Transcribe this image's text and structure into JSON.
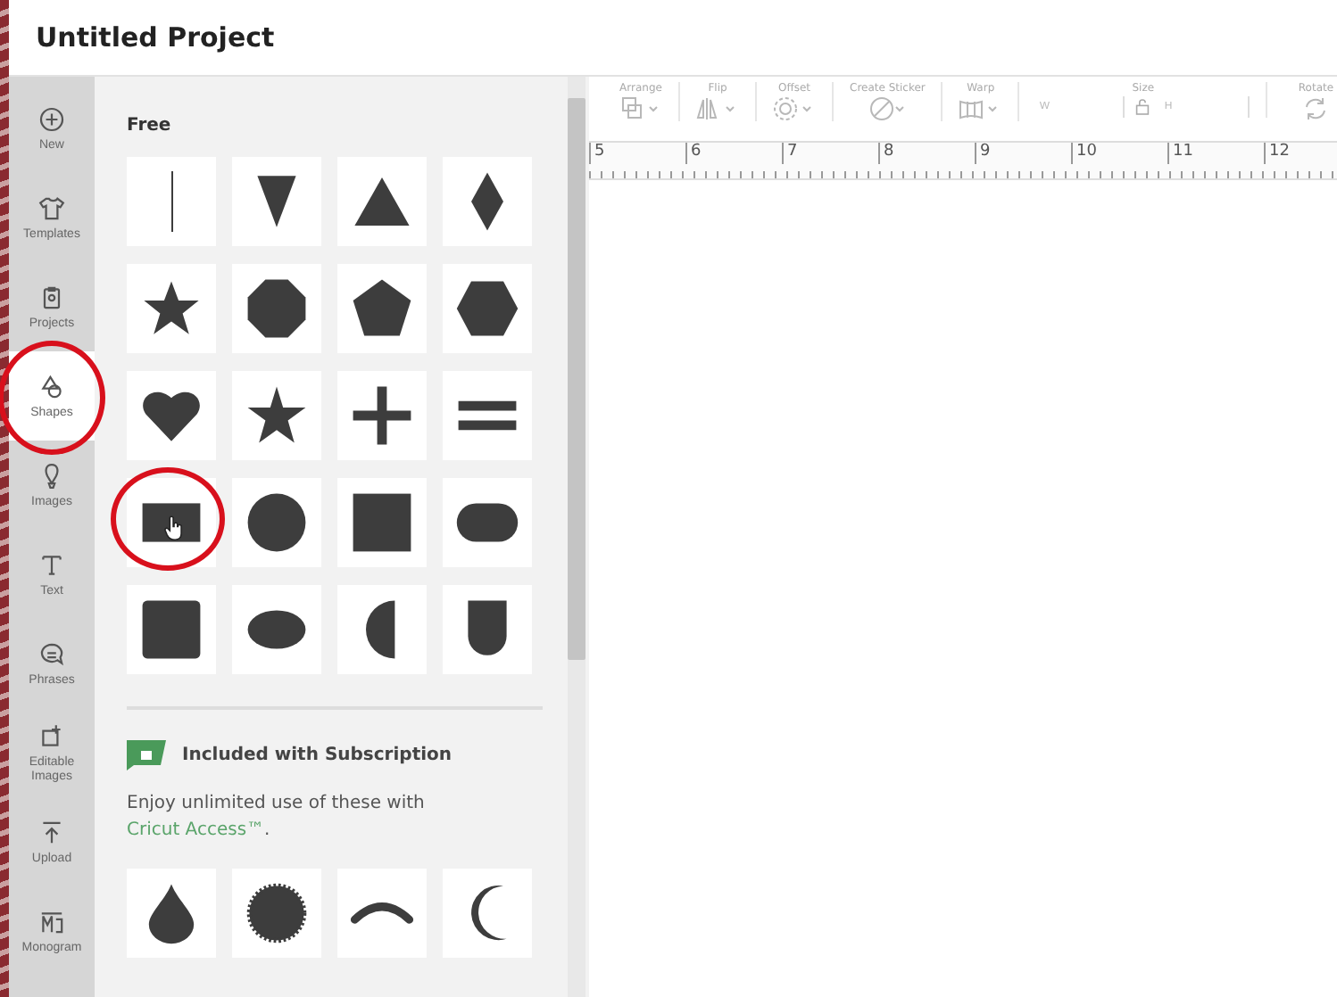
{
  "window": {
    "title": "Untitled Project"
  },
  "sidebar": {
    "items": [
      {
        "label": "New",
        "selected": false,
        "circled": false
      },
      {
        "label": "Templates",
        "selected": false,
        "circled": false
      },
      {
        "label": "Projects",
        "selected": false,
        "circled": false
      },
      {
        "label": "Shapes",
        "selected": true,
        "circled": true
      },
      {
        "label": "Images",
        "selected": false,
        "circled": false
      },
      {
        "label": "Text",
        "selected": false,
        "circled": false
      },
      {
        "label": "Phrases",
        "selected": false,
        "circled": false
      },
      {
        "label": "Editable Images",
        "selected": false,
        "circled": false
      },
      {
        "label": "Upload",
        "selected": false,
        "circled": false
      },
      {
        "label": "Monogram",
        "selected": false,
        "circled": false
      }
    ]
  },
  "panel": {
    "free_heading": "Free",
    "free_shapes": [
      {
        "kind": "line",
        "circled": false,
        "hovered": false
      },
      {
        "kind": "triangle-down",
        "circled": false,
        "hovered": false
      },
      {
        "kind": "triangle",
        "circled": false,
        "hovered": false
      },
      {
        "kind": "diamond",
        "circled": false,
        "hovered": false
      },
      {
        "kind": "star",
        "circled": false,
        "hovered": false
      },
      {
        "kind": "octagon",
        "circled": false,
        "hovered": false
      },
      {
        "kind": "pentagon",
        "circled": false,
        "hovered": false
      },
      {
        "kind": "hexagon",
        "circled": false,
        "hovered": false
      },
      {
        "kind": "heart",
        "circled": false,
        "hovered": false
      },
      {
        "kind": "star-thin",
        "circled": false,
        "hovered": false
      },
      {
        "kind": "plus",
        "circled": false,
        "hovered": false
      },
      {
        "kind": "equals",
        "circled": false,
        "hovered": false
      },
      {
        "kind": "rectangle",
        "circled": true,
        "hovered": true
      },
      {
        "kind": "circle",
        "circled": false,
        "hovered": false
      },
      {
        "kind": "square",
        "circled": false,
        "hovered": false
      },
      {
        "kind": "rounded",
        "circled": false,
        "hovered": false
      },
      {
        "kind": "rounded-square",
        "circled": false,
        "hovered": false
      },
      {
        "kind": "ellipse",
        "circled": false,
        "hovered": false
      },
      {
        "kind": "half-circle",
        "circled": false,
        "hovered": false
      },
      {
        "kind": "shield",
        "circled": false,
        "hovered": false
      }
    ],
    "subscription_heading": "Included with Subscription",
    "subscription_text": "Enjoy unlimited use of these with",
    "subscription_link": "Cricut Access™",
    "subscription_end": ".",
    "subscription_shapes": [
      {
        "kind": "drop"
      },
      {
        "kind": "seal"
      },
      {
        "kind": "arc"
      },
      {
        "kind": "moon"
      }
    ]
  },
  "toolbar": {
    "groups": [
      {
        "label": "Arrange"
      },
      {
        "label": "Flip"
      },
      {
        "label": "Offset"
      },
      {
        "label": "Create Sticker"
      },
      {
        "label": "Warp"
      }
    ],
    "size": {
      "label": "Size",
      "width_placeholder": "W",
      "height_placeholder": "H"
    },
    "rotate": {
      "label": "Rotate"
    }
  },
  "ruler": {
    "marks": [
      "5",
      "6",
      "7",
      "8",
      "9",
      "10",
      "11",
      "12"
    ]
  }
}
